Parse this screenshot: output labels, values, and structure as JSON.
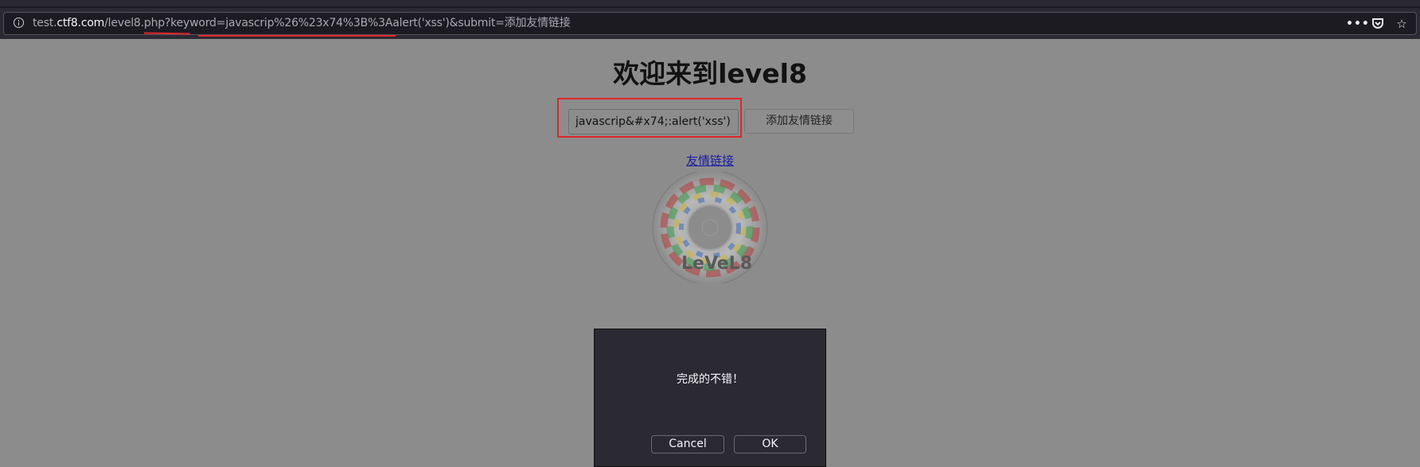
{
  "browser": {
    "url_pre": "test.",
    "url_domain": "ctf8.com",
    "url_rest": "/level8.php?keyword=javascrip%26%23x74%3B%3Aalert('xss')&submit=添加友情链接",
    "icons": [
      "info-icon",
      "more-icon",
      "pocket-icon",
      "bookmark-star-icon"
    ],
    "more_glyph": "•••",
    "star_glyph": "☆"
  },
  "page": {
    "title": "欢迎来到level8",
    "keyword_value": "javascrip&#x74;:alert('xss')",
    "submit_label": "添加友情链接",
    "friend_link": "友情链接",
    "disc_text": "LeVeL8"
  },
  "dialog": {
    "message": "完成的不错！",
    "cancel_label": "Cancel",
    "ok_label": "OK"
  },
  "colors": {
    "page_bg": "#8c8c8c",
    "toolbar_bg": "#2b2a33",
    "highlight_red": "#e0262a",
    "link_blue": "#1d1da6"
  }
}
